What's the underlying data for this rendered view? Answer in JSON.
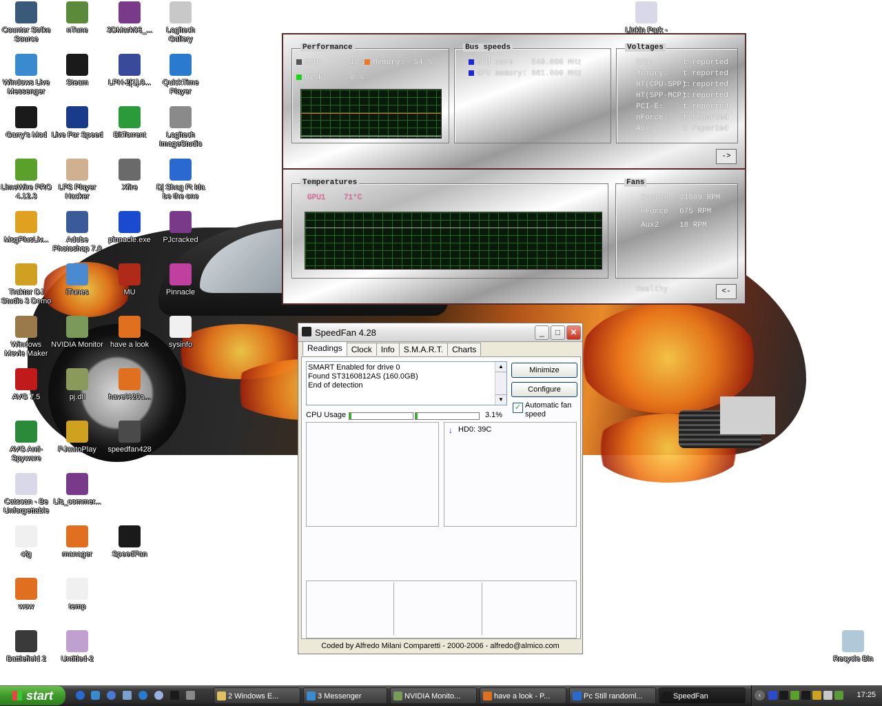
{
  "desktop_icons": [
    {
      "label": "Counter Strike Source",
      "name": "counter-strike-icon",
      "color": "#3a5a7a"
    },
    {
      "label": "nTune",
      "name": "ntune-icon",
      "color": "#5a8a3a"
    },
    {
      "label": "3DMark06_...",
      "name": "winrar-icon",
      "color": "#7a3a8a"
    },
    {
      "label": "Logitech Gallery",
      "name": "logitech-gallery-icon",
      "color": "#c8c8c8"
    },
    {
      "label": "Windows Live Messenger",
      "name": "messenger-icon",
      "color": "#3a8ad0"
    },
    {
      "label": "Steam",
      "name": "steam-icon",
      "color": "#1a1a1a"
    },
    {
      "label": "LPH-2[1].0...",
      "name": "lph-icon",
      "color": "#3a4a9a"
    },
    {
      "label": "QuickTime Player",
      "name": "quicktime-icon",
      "color": "#2a7ad0"
    },
    {
      "label": "Garry's Mod",
      "name": "garrys-mod-icon",
      "color": "#1a1a1a"
    },
    {
      "label": "Live For Speed",
      "name": "live-for-speed-icon",
      "color": "#1a3a8a"
    },
    {
      "label": "BitTorrent",
      "name": "bittorrent-icon",
      "color": "#2a9a3a"
    },
    {
      "label": "Logitech ImageStudio",
      "name": "logitech-imagestudio-icon",
      "color": "#8a8a8a"
    },
    {
      "label": "LimeWire PRO 4.12.3",
      "name": "limewire-icon",
      "color": "#5aa02a"
    },
    {
      "label": "LFS Player Hacker",
      "name": "lfs-player-hacker-icon",
      "color": "#d0b090"
    },
    {
      "label": "Xfire",
      "name": "xfire-icon",
      "color": "#6a6a6a"
    },
    {
      "label": "Dj Shog Ft Ida be the one",
      "name": "ie-icon",
      "color": "#2a6ad0"
    },
    {
      "label": "MsgPlusLiv...",
      "name": "msgplus-icon",
      "color": "#e0a020"
    },
    {
      "label": "Adobe Photoshop 7.0",
      "name": "photoshop-icon",
      "color": "#3a5a9a"
    },
    {
      "label": "pinnacle.exe",
      "name": "pinnacle-exe-icon",
      "color": "#1a4ad0"
    },
    {
      "label": "PJcracked",
      "name": "pjcracked-icon",
      "color": "#7a3a8a"
    },
    {
      "label": "Traktor DJ Studio 3 Demo",
      "name": "traktor-icon",
      "color": "#d0a020"
    },
    {
      "label": "iTunes",
      "name": "itunes-icon",
      "color": "#4a8ad0"
    },
    {
      "label": "MU",
      "name": "mu-icon",
      "color": "#b02a1a"
    },
    {
      "label": "Pinnacle",
      "name": "pinnacle-icon",
      "color": "#c040a0"
    },
    {
      "label": "Windows Movie Maker",
      "name": "movie-maker-icon",
      "color": "#9a7a4a"
    },
    {
      "label": "NVIDIA Monitor",
      "name": "nvidia-monitor-icon",
      "color": "#7a9a5a"
    },
    {
      "label": "have a look",
      "name": "have-a-look-icon",
      "color": "#e07020"
    },
    {
      "label": "sysinfo",
      "name": "sysinfo-icon",
      "color": "#f0f0f0"
    },
    {
      "label": "AVG 7.5",
      "name": "avg-icon",
      "color": "#c01a1a"
    },
    {
      "label": "pj.dll",
      "name": "pj-dll-icon",
      "color": "#8a9a5a"
    },
    {
      "label": "have%20a...",
      "name": "have-a-icon",
      "color": "#e07020"
    },
    {
      "label": "AVG Anti-Spyware",
      "name": "avg-antispyware-icon",
      "color": "#2a8a3a"
    },
    {
      "label": "PJautoPlay",
      "name": "pjautoplay-icon",
      "color": "#d0a020"
    },
    {
      "label": "speedfan428",
      "name": "speedfan-installer-icon",
      "color": "#4a4a4a"
    },
    {
      "label": "Catscan - Be Unforgettable",
      "name": "mp3-icon",
      "color": "#d8d8e8"
    },
    {
      "label": "Lfs_commer...",
      "name": "lfs-commer-icon",
      "color": "#7a3a8a"
    },
    {
      "label": "cfg",
      "name": "cfg-icon",
      "color": "#f0f0f0"
    },
    {
      "label": "manager",
      "name": "manager-icon",
      "color": "#e07020"
    },
    {
      "label": "SpeedFan",
      "name": "speedfan-icon",
      "color": "#1a1a1a"
    },
    {
      "label": "wow",
      "name": "wow-icon",
      "color": "#e07020"
    },
    {
      "label": "temp",
      "name": "temp-icon",
      "color": "#f0f0f0"
    },
    {
      "label": "Battlefield 2",
      "name": "battlefield-icon",
      "color": "#3a3a3a"
    },
    {
      "label": "Untitled-2",
      "name": "untitled-icon",
      "color": "#c0a0d0"
    },
    {
      "label": "Linkin Park -",
      "name": "linkin-park-icon",
      "color": "#d8d8e8"
    },
    {
      "label": "Recycle Bin",
      "name": "recycle-bin-icon",
      "color": "#b0c8d8"
    }
  ],
  "perf": {
    "performance_title": "Performance",
    "cpu_label": "CPU:",
    "cpu_value": "1 %",
    "memory_label": "Memory:",
    "memory_value": "54 %",
    "disk_label": "Disk:",
    "disk_value": "0 %",
    "bus_title": "Bus speeds",
    "gpu_core_label": "GPU core",
    "gpu_core_value": "540.000 MHz",
    "gpu_mem_label": "GPU memory:",
    "gpu_mem_value": "661.000 MHz",
    "volt_title": "Voltages",
    "voltages": [
      {
        "label": "CPU:",
        "value": "t reported"
      },
      {
        "label": "Memory:",
        "value": "t reported"
      },
      {
        "label": "HT(CPU-SPP):",
        "value": "t reported"
      },
      {
        "label": "HT(SPP-MCP):",
        "value": "t reported"
      },
      {
        "label": "PCI-E:",
        "value": "t reported"
      },
      {
        "label": "nForce:",
        "value": "t reported"
      },
      {
        "label": "Aux:",
        "value": "t reported"
      }
    ],
    "forward_button": "->",
    "colors": {
      "cpu": "#555555",
      "memory": "#f07820",
      "disk": "#20d020",
      "bus": "#1a2ad0",
      "gpu_temp": "#ff5aa0"
    }
  },
  "temps": {
    "temps_title": "Temperatures",
    "gpu_label": "GPU1",
    "gpu_value": "71°C",
    "fans_title": "Fans",
    "fans": [
      {
        "label": "System",
        "value": "31889 RPM"
      },
      {
        "label": "nForce",
        "value": "675 RPM"
      },
      {
        "label": "Aux2",
        "value": "18 RPM"
      }
    ],
    "status": "Healthy",
    "back_button": "<-"
  },
  "speedfan": {
    "title": "SpeedFan 4.28",
    "tabs": [
      "Readings",
      "Clock",
      "Info",
      "S.M.A.R.T.",
      "Charts"
    ],
    "log": [
      "SMART Enabled for drive 0",
      "Found ST3160812AS (160.0GB)",
      "End of detection"
    ],
    "minimize_label": "Minimize",
    "configure_label": "Configure",
    "auto_fan_label": "Automatic fan speed",
    "auto_fan_checked": true,
    "cpu_usage_label": "CPU Usage",
    "cpu_usage_value": "3.1%",
    "cpu_usage_level_1": 0.03,
    "cpu_usage_level_2": 0.03,
    "hd_temp": "HD0: 39C",
    "footer": "Coded by Alfredo Milani Comparetti - 2000-2006 - alfredo@almico.com"
  },
  "taskbar": {
    "start_label": "start",
    "tasks": [
      {
        "label": "2 Windows E...",
        "color": "#e0c060"
      },
      {
        "label": "3 Messenger",
        "color": "#3a8ad0"
      },
      {
        "label": "NVIDIA Monito...",
        "color": "#7a9a5a"
      },
      {
        "label": "have a look - P...",
        "color": "#e07020"
      },
      {
        "label": "Pc Still randoml...",
        "color": "#2a6ad0"
      },
      {
        "label": "SpeedFan",
        "color": "#1a1a1a"
      }
    ],
    "clock": "17:25"
  }
}
